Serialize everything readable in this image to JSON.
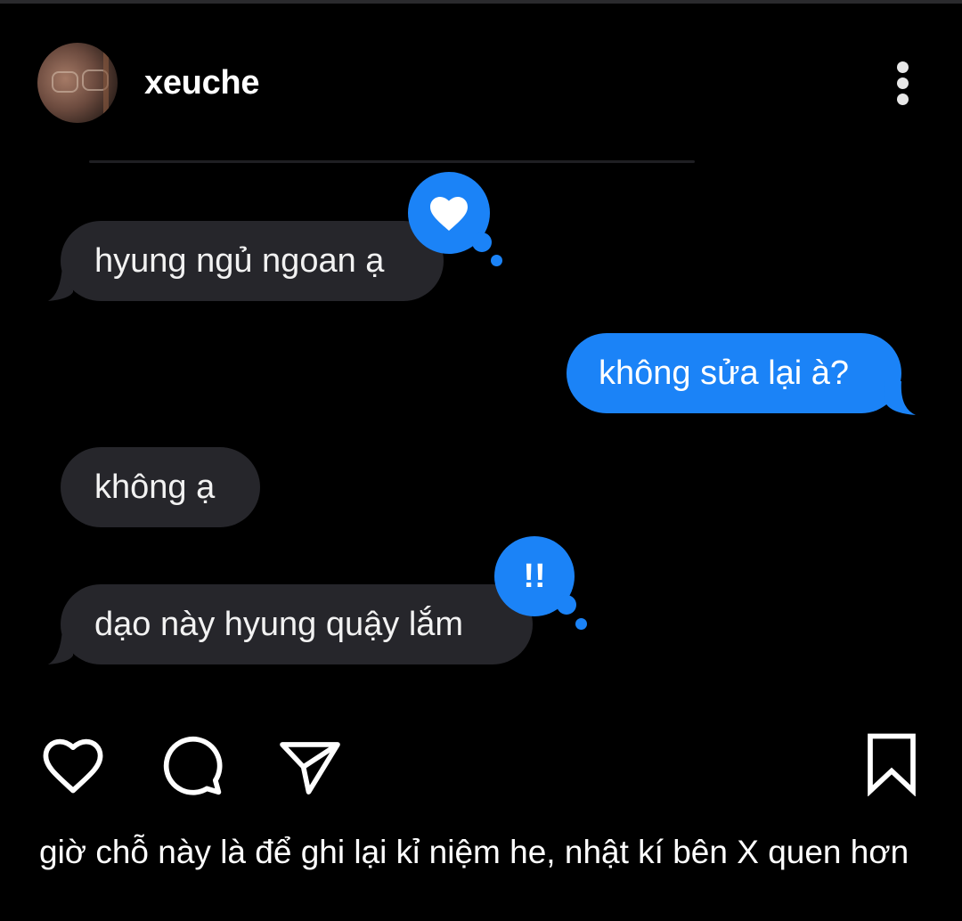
{
  "post": {
    "username": "xeuche",
    "caption": "giờ chỗ này là để ghi lại kỉ niệm he, nhật kí bên X quen hơn"
  },
  "messages": [
    {
      "side": "incoming",
      "text": "hyung ngủ ngoan ạ",
      "reaction": "heart-icon"
    },
    {
      "side": "outgoing",
      "text": "không sửa lại à?"
    },
    {
      "side": "incoming",
      "text": "không ạ"
    },
    {
      "side": "incoming",
      "text": "dạo này hyung quậy lắm",
      "reaction": "!!"
    }
  ],
  "colors": {
    "background": "#000000",
    "incoming_bubble": "#26262b",
    "outgoing_bubble": "#1b83f7",
    "reaction": "#1b83f7"
  },
  "actions": [
    "heart-icon",
    "comment-icon",
    "share-icon",
    "bookmark-icon"
  ]
}
